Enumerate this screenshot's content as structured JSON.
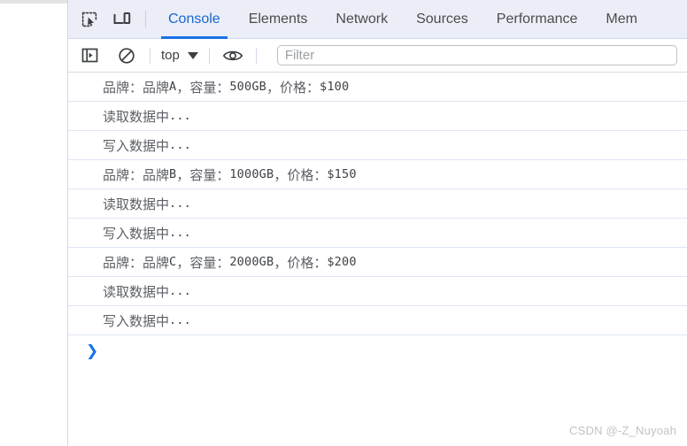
{
  "window": {
    "app": "Chrome DevTools"
  },
  "tabbar": {
    "icons": [
      {
        "name": "inspect-element-icon",
        "label": "Inspect element"
      },
      {
        "name": "device-toolbar-icon",
        "label": "Toggle device toolbar"
      }
    ],
    "tabs": [
      {
        "label": "Console",
        "active": true
      },
      {
        "label": "Elements",
        "active": false
      },
      {
        "label": "Network",
        "active": false
      },
      {
        "label": "Sources",
        "active": false
      },
      {
        "label": "Performance",
        "active": false
      },
      {
        "label": "Mem",
        "active": false
      }
    ],
    "active_tab": "Console",
    "accent_color": "#1a73e8",
    "background_color": "#ebeef7"
  },
  "console_toolbar": {
    "sidebar_toggle": {
      "name": "show-console-sidebar-icon",
      "label": "Show console sidebar"
    },
    "clear_console": {
      "name": "clear-console-icon",
      "label": "Clear console"
    },
    "context_selector": {
      "value": "top",
      "caret": "chevron-down-icon"
    },
    "live_expression": {
      "name": "eye-icon",
      "label": "Create live expression"
    },
    "filter": {
      "placeholder": "Filter",
      "value": ""
    }
  },
  "console": {
    "messages": [
      {
        "zh": "品牌：品牌",
        "mono": "A",
        "zh2": "，容量：",
        "mono2": "500GB",
        "zh3": "，价格：",
        "mono3": "$100"
      },
      {
        "zh": "读取数据中",
        "mono": "...",
        "zh2": "",
        "mono2": "",
        "zh3": "",
        "mono3": ""
      },
      {
        "zh": "写入数据中",
        "mono": "...",
        "zh2": "",
        "mono2": "",
        "zh3": "",
        "mono3": ""
      },
      {
        "zh": "品牌：品牌",
        "mono": "B",
        "zh2": "，容量：",
        "mono2": "1000GB",
        "zh3": "，价格：",
        "mono3": "$150"
      },
      {
        "zh": "读取数据中",
        "mono": "...",
        "zh2": "",
        "mono2": "",
        "zh3": "",
        "mono3": ""
      },
      {
        "zh": "写入数据中",
        "mono": "...",
        "zh2": "",
        "mono2": "",
        "zh3": "",
        "mono3": ""
      },
      {
        "zh": "品牌：品牌",
        "mono": "C",
        "zh2": "，容量：",
        "mono2": "2000GB",
        "zh3": "，价格：",
        "mono3": "$200"
      },
      {
        "zh": "读取数据中",
        "mono": "...",
        "zh2": "",
        "mono2": "",
        "zh3": "",
        "mono3": ""
      },
      {
        "zh": "写入数据中",
        "mono": "...",
        "zh2": "",
        "mono2": "",
        "zh3": "",
        "mono3": ""
      }
    ],
    "prompt": {
      "chevron": "❯",
      "value": ""
    }
  },
  "watermark": {
    "text": "CSDN @-Z_Nuyoah"
  }
}
